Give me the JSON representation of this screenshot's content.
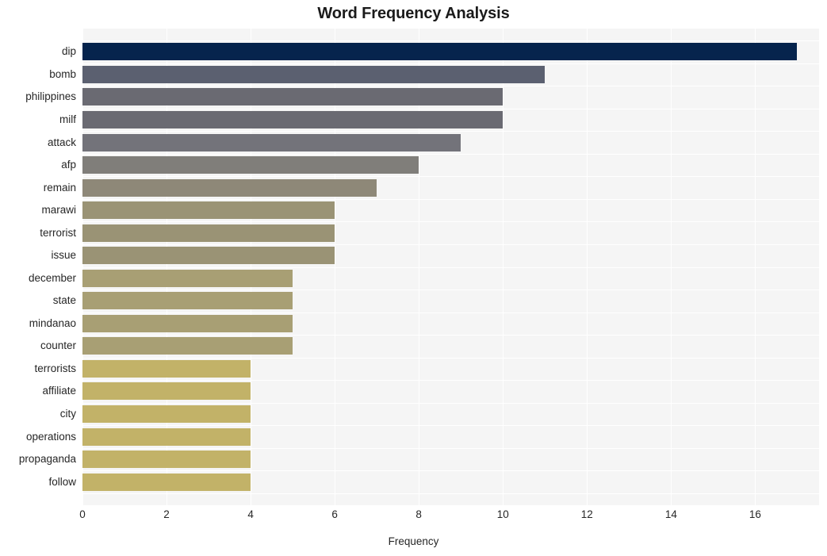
{
  "chart_data": {
    "type": "bar",
    "orientation": "horizontal",
    "title": "Word Frequency Analysis",
    "xlabel": "Frequency",
    "ylabel": "",
    "categories": [
      "dip",
      "bomb",
      "philippines",
      "milf",
      "attack",
      "afp",
      "remain",
      "marawi",
      "terrorist",
      "issue",
      "december",
      "state",
      "mindanao",
      "counter",
      "terrorists",
      "affiliate",
      "city",
      "operations",
      "propaganda",
      "follow"
    ],
    "values": [
      17,
      11,
      10,
      10,
      9,
      8,
      7,
      6,
      6,
      6,
      5,
      5,
      5,
      5,
      4,
      4,
      4,
      4,
      4,
      4
    ],
    "bar_colors": [
      "#06244d",
      "#5b6070",
      "#6a6a72",
      "#6a6a72",
      "#73737a",
      "#807e7a",
      "#8e8878",
      "#9a9375",
      "#9a9375",
      "#9a9375",
      "#a89f74",
      "#a89f74",
      "#a89f74",
      "#a89f74",
      "#c2b268",
      "#c2b268",
      "#c2b268",
      "#c2b268",
      "#c2b268",
      "#c2b268"
    ],
    "xlim": [
      0,
      17.52
    ],
    "xticks": [
      0,
      2,
      4,
      6,
      8,
      10,
      12,
      14,
      16
    ],
    "xtick_labels": [
      "0",
      "2",
      "4",
      "6",
      "8",
      "10",
      "12",
      "14",
      "16"
    ],
    "grid": true,
    "grid_color": "#ffffff",
    "plot_background": "#f5f5f5",
    "figure_background": "#ffffff",
    "legend": null
  }
}
